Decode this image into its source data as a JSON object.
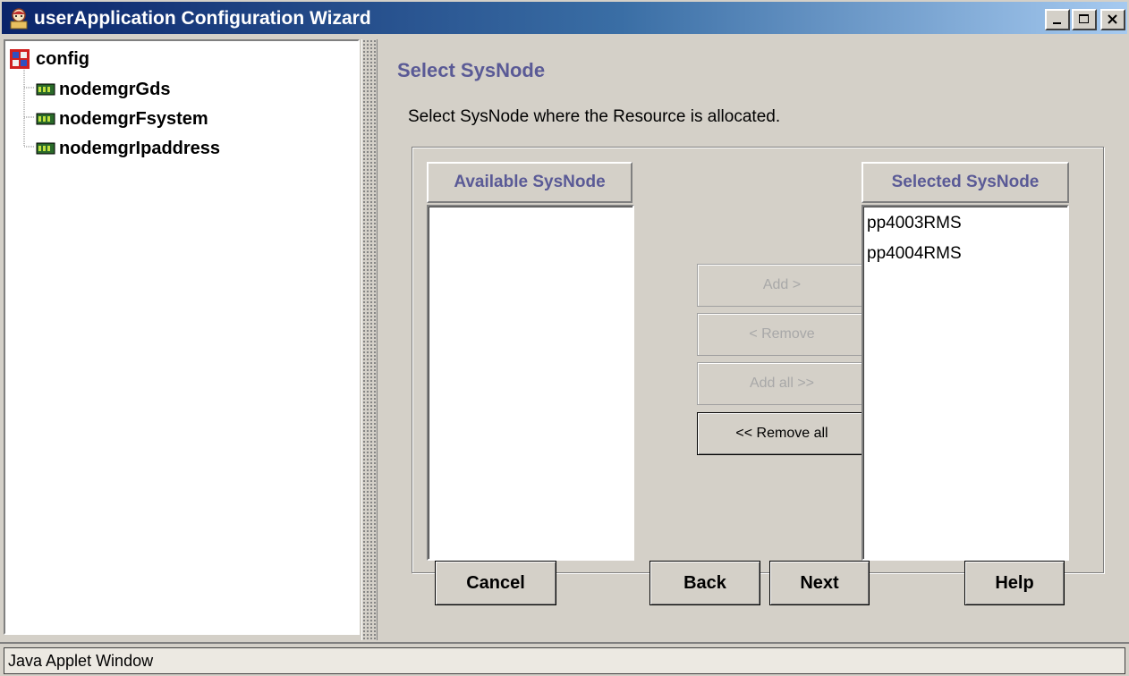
{
  "window": {
    "title": "userApplication Configuration Wizard",
    "app_icon": "wizard-app-icon",
    "controls": [
      "minimize-icon",
      "maximize-icon",
      "close-icon"
    ]
  },
  "tree": {
    "root": {
      "label": "config",
      "icon": "config-folder-icon"
    },
    "children": [
      {
        "label": "nodemgrGds",
        "icon": "resource-icon"
      },
      {
        "label": "nodemgrFsystem",
        "icon": "resource-icon"
      },
      {
        "label": "nodemgrIpaddress",
        "icon": "resource-icon"
      }
    ]
  },
  "page": {
    "title": "Select SysNode",
    "instruction": "Select SysNode where the Resource is allocated."
  },
  "available": {
    "header": "Available SysNode",
    "items": []
  },
  "selected": {
    "header": "Selected SysNode",
    "items": [
      "pp4003RMS",
      "pp4004RMS"
    ]
  },
  "transfer_buttons": {
    "add": "Add >",
    "remove": "< Remove",
    "add_all": "Add all >>",
    "remove_all": "<< Remove all"
  },
  "footer_buttons": {
    "cancel": "Cancel",
    "back": "Back",
    "next": "Next",
    "help": "Help"
  },
  "status": {
    "text": "Java Applet Window"
  },
  "colors": {
    "title_gradient_start": "#0a246a",
    "title_gradient_end": "#a6caf0",
    "heading": "#5a5a96",
    "face": "#d4d0c8"
  }
}
